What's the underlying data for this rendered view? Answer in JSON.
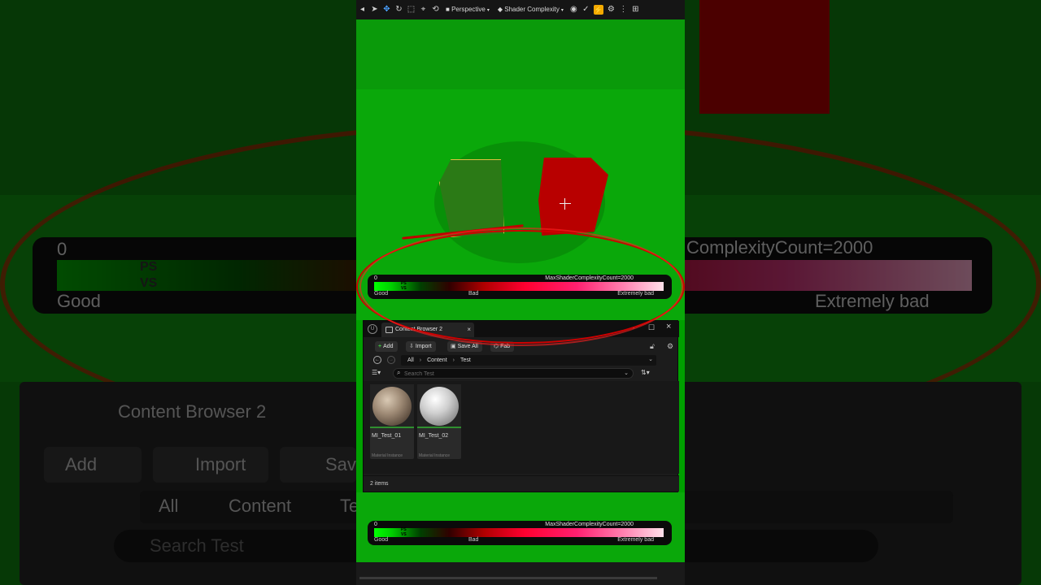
{
  "toolbar": {
    "perspective_label": "Perspective",
    "view_mode_label": "Shader Complexity"
  },
  "legend": {
    "zero_label": "0",
    "max_label": "MaxShaderComplexityCount=2000",
    "ps_label": "PS",
    "vs_label": "VS",
    "good_label": "Good",
    "bad_label": "Bad",
    "extremely_bad_label": "Extremely bad"
  },
  "content_browser": {
    "tab_label": "Content Browser 2",
    "actions": {
      "add_label": "Add",
      "import_label": "Import",
      "save_all_label": "Save All",
      "fab_label": "Fab"
    },
    "breadcrumbs": [
      "All",
      "Content",
      "Test"
    ],
    "search_placeholder": "Search Test",
    "assets": [
      {
        "name": "MI_Test_01",
        "type": "Material Instance"
      },
      {
        "name": "MI_Test_02",
        "type": "Material Instance"
      }
    ],
    "status": "2 items"
  },
  "background": {
    "zero_label": "0",
    "max_label": "ComplexityCount=2000",
    "ps_label": "PS",
    "vs_label": "VS",
    "good_label": "Good",
    "extremely_bad_label": "Extremely bad",
    "tab_label": "Content Browser 2",
    "add_label": "Add",
    "import_label": "Import",
    "save_fragment": "Sav",
    "crumb_all": "All",
    "crumb_content": "Content",
    "crumb_fragment": "Te",
    "search_placeholder": "Search Test"
  },
  "colors": {
    "viewport_green": "#00a000",
    "selection_outline": "#e2c040",
    "red_box": "#b80000",
    "annotation_red": "#d00000",
    "accent_yellow": "#f2a900"
  }
}
